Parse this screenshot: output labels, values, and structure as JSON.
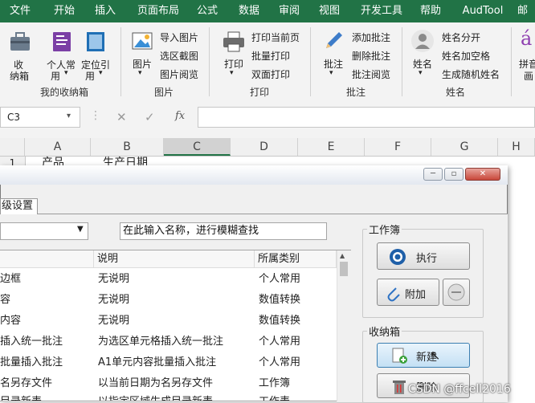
{
  "menu": [
    "文件",
    "开始",
    "插入",
    "页面布局",
    "公式",
    "数据",
    "审阅",
    "视图",
    "开发工具",
    "帮助",
    "AudTool",
    "邮"
  ],
  "ribbon": {
    "storage_box": {
      "btn1": "收",
      "btn1b": "纳箱",
      "btn2": "个人常",
      "btn2b": "用",
      "btn3": "定位引",
      "btn3b": "用",
      "group": "我的收纳箱"
    },
    "picture": {
      "big": "图片",
      "items": [
        "导入图片",
        "选区截图",
        "图片阅览"
      ],
      "group": "图片"
    },
    "print": {
      "big": "打印",
      "items": [
        "打印当前页",
        "批量打印",
        "双面打印"
      ],
      "group": "打印"
    },
    "comment": {
      "big": "批注",
      "items": [
        "添加批注",
        "删除批注",
        "批注阅览"
      ],
      "group": "批注"
    },
    "name": {
      "big": "姓名",
      "items": [
        "姓名分开",
        "姓名加空格",
        "生成随机姓名"
      ],
      "group": "姓名"
    },
    "pinyin": {
      "big": "拼音",
      "big2": "画"
    }
  },
  "namebox": "C3",
  "fx": "fx",
  "columns": [
    "A",
    "B",
    "C",
    "D",
    "E",
    "F",
    "G",
    "H"
  ],
  "row1": {
    "num": "1",
    "a": "产品",
    "b": "生产日期"
  },
  "dialog": {
    "tab": "级设置",
    "search_placeholder": "在此输入名称，进行模糊查找",
    "headers": {
      "desc": "说明",
      "cat": "所属类别"
    },
    "rows": [
      {
        "name": "边框",
        "desc": "无说明",
        "cat": "个人常用"
      },
      {
        "name": "容",
        "desc": "无说明",
        "cat": "数值转换"
      },
      {
        "name": "内容",
        "desc": "无说明",
        "cat": "数值转换"
      },
      {
        "name": "插入统一批注",
        "desc": "为选区单元格插入统一批注",
        "cat": "个人常用"
      },
      {
        "name": "批量插入批注",
        "desc": "A1单元内容批量插入批注",
        "cat": "个人常用"
      },
      {
        "name": "名另存文件",
        "desc": "以当前日期为名另存文件",
        "cat": "工作簿"
      },
      {
        "name": "目录新表",
        "desc": "以指定区域生成目录新表",
        "cat": "工作表"
      }
    ],
    "workbook_group": "工作簿",
    "execute": "执行",
    "attach": "附加",
    "storage_group": "收纳箱",
    "new": "新建",
    "delete": "删除"
  },
  "watermark": "CSDN @ffcell2016",
  "colors": {
    "excel_green": "#217346",
    "ribbon_bg": "#f3f3f3",
    "selected_col": "#d2d2d2"
  }
}
